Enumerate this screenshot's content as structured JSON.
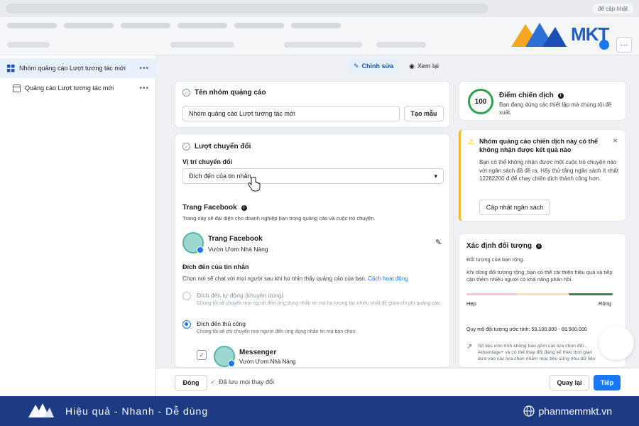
{
  "browser": {
    "update_label": "để cập nhật"
  },
  "logo": {
    "text": "MKT"
  },
  "sidebar": {
    "items": [
      {
        "label": "Nhóm quảng cáo Lượt tương tác mới",
        "more": "•••"
      },
      {
        "label": "Quảng cáo Lượt tương tác mới",
        "more": "•••"
      }
    ]
  },
  "mode_tabs": {
    "edit": "Chỉnh sửa",
    "review": "Xem lại"
  },
  "ad_group_name": {
    "title": "Tên nhóm quảng cáo",
    "value": "Nhóm quảng cáo Lượt tương tác mới",
    "template_button": "Tạo mẫu"
  },
  "conversion": {
    "title": "Lượt chuyển đổi",
    "location_label": "Vị trí chuyển đổi",
    "location_value": "Đích đến của tin nhắn",
    "fb_page_label": "Trang Facebook",
    "fb_page_desc": "Trang này sẽ đại diện cho doanh nghiệp bạn trong quảng cáo và cuộc trò chuyện.",
    "page_name": "Trang Facebook",
    "page_sub": "Vườn Ươm Nhà Nàng",
    "dest_label": "Đích đến của tin nhắn",
    "dest_desc": "Chọn nơi sẽ chat với mọi người sau khi họ nhìn thấy quảng cáo của bạn.",
    "dest_link": "Cách hoạt động",
    "auto_title": "Đích đến tự động (khuyên dùng)",
    "auto_desc": "Chúng tôi sẽ chuyển mọi người đến ứng dụng nhắn tin mà họ tương tác nhiều nhất để giảm chi phí quảng cáo.",
    "manual_title": "Đích đến thủ công",
    "manual_desc": "Chúng tôi sẽ chỉ chuyển mọi người đến ứng dụng nhắn tin mà bạn chọn.",
    "messenger_title": "Messenger",
    "messenger_sub": "Vườn Ươm Nhà Nàng"
  },
  "score": {
    "value": "100",
    "title": "Điểm chiến dịch",
    "desc": "Bạn đang dùng các thiết lập mà chúng tôi đề xuất."
  },
  "warning": {
    "title": "Nhóm quảng cáo chiến dịch này có thể không nhận được kết quả nào",
    "body": "Bạn có thể không nhận được một cuộc trò chuyện nào với ngân sách đã đề ra. Hãy thử tăng ngân sách ít nhất 12282200 đ để chạy chiến dịch thành công hơn.",
    "button": "Cập nhật ngân sách"
  },
  "audience": {
    "title": "Xác định đối tượng",
    "status": "Đối tượng của bạn rộng.",
    "desc": "Khi dùng đối tượng rộng, bạn có thể cải thiện hiệu quả và tiếp cận thêm nhiều người có khả năng phản hồi.",
    "narrow": "Hẹp",
    "wide": "Rộng",
    "estimate": "Quy mô đối tượng ước tính: 59.100.000 - 69.500.000",
    "note": "Số liệu ước tính không bao gồm các lựa chọn đối... Advantage+ và có thể thay đổi đáng kể theo thời gian dựa vào các lựa chọn nhắm mục tiêu cũng như dữ liệu"
  },
  "footer": {
    "close": "Đóng",
    "saved": "Đã lưu mọi thay đổi",
    "back": "Quay lại",
    "next": "Tiếp"
  },
  "banner": {
    "slogan": "Hiệu quả - Nhanh - Dễ dùng",
    "site": "phanmemmkt.vn"
  }
}
